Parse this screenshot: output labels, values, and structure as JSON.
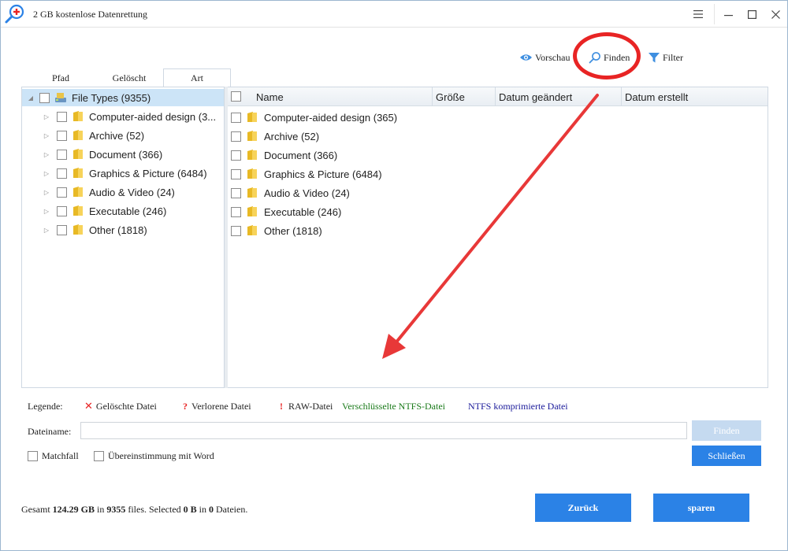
{
  "window": {
    "title": "2 GB kostenlose Datenrettung",
    "menu_icon": "hamburger-icon",
    "minimize_icon": "minimize-icon",
    "maximize_icon": "maximize-icon",
    "close_icon": "close-icon"
  },
  "toolbar": {
    "preview_label": "Vorschau",
    "find_label": "Finden",
    "filter_label": "Filter",
    "highlight_color": "#e82424"
  },
  "tabs": [
    {
      "label": "Pfad",
      "active": false
    },
    {
      "label": "Gelöscht",
      "active": false
    },
    {
      "label": "Art",
      "active": true
    }
  ],
  "tree": {
    "root_label": "File Types (9355)",
    "items": [
      {
        "label": "Computer-aided design (3..."
      },
      {
        "label": "Archive (52)"
      },
      {
        "label": "Document (366)"
      },
      {
        "label": "Graphics & Picture (6484)"
      },
      {
        "label": "Audio & Video (24)"
      },
      {
        "label": "Executable (246)"
      },
      {
        "label": "Other (1818)"
      }
    ]
  },
  "list": {
    "columns": [
      "Name",
      "Größe",
      "Datum geändert",
      "Datum erstellt"
    ],
    "rows": [
      {
        "name": "Computer-aided design (365)"
      },
      {
        "name": "Archive (52)"
      },
      {
        "name": "Document (366)"
      },
      {
        "name": "Graphics & Picture (6484)"
      },
      {
        "name": "Audio & Video (24)"
      },
      {
        "name": "Executable (246)"
      },
      {
        "name": "Other (1818)"
      }
    ]
  },
  "legend": {
    "title": "Legende:",
    "deleted": "Gelöschte Datei",
    "lost": "Verlorene Datei",
    "raw": "RAW-Datei",
    "encrypted": "Verschlüsselte NTFS-Datei",
    "compressed": "NTFS komprimierte Datei",
    "encrypted_color": "#1a7a1a",
    "compressed_color": "#1a1a9a"
  },
  "search": {
    "filename_label": "Dateiname:",
    "filename_value": "",
    "find_button": "Finden",
    "close_button": "Schließen",
    "matchcase_label": "Matchfall",
    "wholeword_label": "Übereinstimmung mit Word"
  },
  "status": {
    "prefix": "Gesamt",
    "total_size": "124.29 GB",
    "in1": "in",
    "file_count": "9355",
    "files_word": "files. Selected",
    "selected_size": "0 B",
    "in2": "in",
    "selected_count": "0",
    "files_suffix": "Dateien."
  },
  "actions": {
    "back_button": "Zurück",
    "save_button": "sparen",
    "accent_color": "#2b82e6"
  }
}
